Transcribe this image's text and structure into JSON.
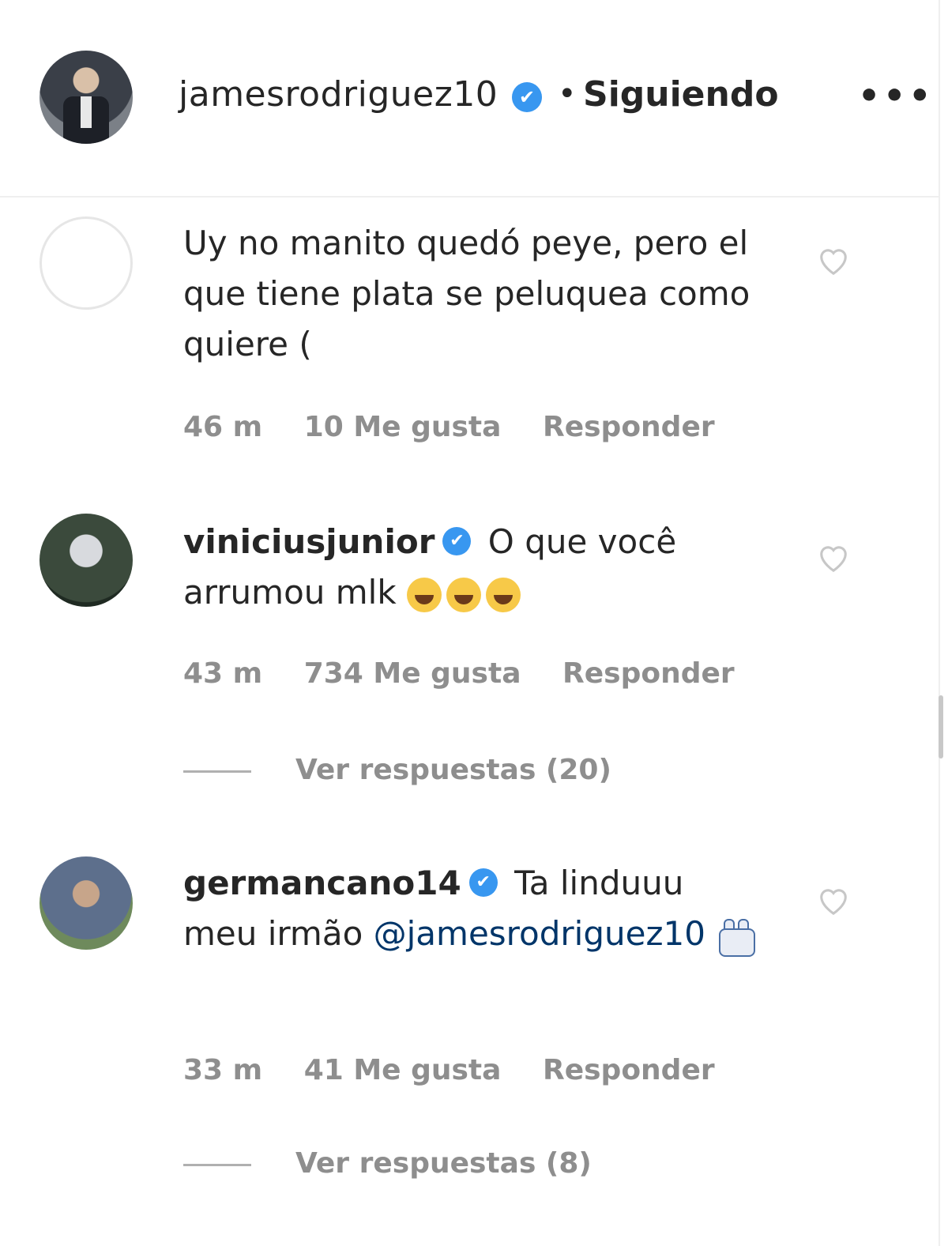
{
  "header": {
    "username": "jamesrodriguez10",
    "verified": "✔",
    "separator": "•",
    "follow_status": "Siguiendo",
    "more": "•••"
  },
  "comments": [
    {
      "user": "",
      "text_cut": "Uy no manito quedó peye, pero el que tiene plata se peluquea como quiere (",
      "time": "46 m",
      "likes": "10 Me gusta",
      "reply": "Responder"
    },
    {
      "user": "viniciusjunior",
      "verified": "✔",
      "text": "O que você arrumou mlk",
      "emoji": "😂😂😂",
      "time": "43 m",
      "likes": "734 Me gusta",
      "reply": "Responder",
      "view_replies": "Ver respuestas (20)"
    },
    {
      "user": "germancano14",
      "verified": "✔",
      "text": "Ta linduuu meu irmão",
      "mention": "@jamesrodriguez10",
      "time": "33 m",
      "likes": "41 Me gusta",
      "reply": "Responder",
      "view_replies": "Ver respuestas (8)"
    }
  ],
  "colors": {
    "verified": "#3897f0",
    "muted": "#8e8e8e",
    "text": "#262626",
    "mention": "#003569"
  }
}
